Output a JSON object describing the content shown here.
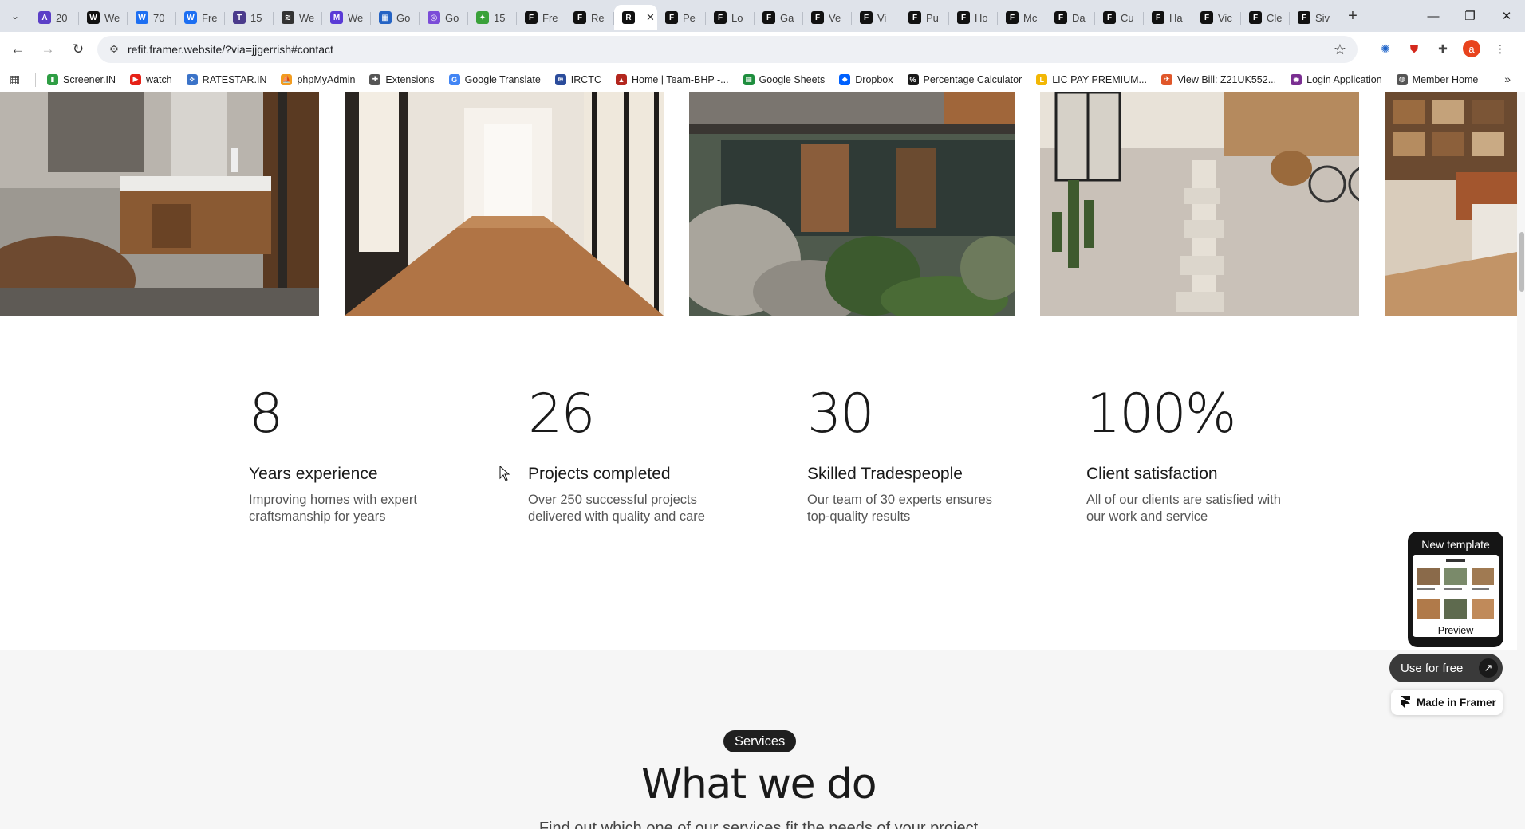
{
  "browser": {
    "tabs": [
      {
        "label": "20",
        "favicon": "arc-icon",
        "color": "#5b3fc7",
        "glyph": "A"
      },
      {
        "label": "We",
        "favicon": "wix-icon",
        "color": "#111111",
        "glyph": "W"
      },
      {
        "label": "70",
        "favicon": "framer-blue-icon",
        "color": "#1d6ff2",
        "glyph": "W"
      },
      {
        "label": "Fre",
        "favicon": "framer-blue-icon",
        "color": "#1d6ff2",
        "glyph": "W"
      },
      {
        "label": "15",
        "favicon": "template-icon",
        "color": "#4b3b8c",
        "glyph": "T"
      },
      {
        "label": "We",
        "favicon": "webflow-icon",
        "color": "#333333",
        "glyph": "≋"
      },
      {
        "label": "We",
        "favicon": "webflow-icon",
        "color": "#5a3bd6",
        "glyph": "M"
      },
      {
        "label": "Go",
        "favicon": "calendar-icon",
        "color": "#2463c4",
        "glyph": "▦"
      },
      {
        "label": "Go",
        "favicon": "circle-icon",
        "color": "#7b4cd8",
        "glyph": "◎"
      },
      {
        "label": "15",
        "favicon": "leaf-icon",
        "color": "#3aa13a",
        "glyph": "✦"
      },
      {
        "label": "Fre",
        "favicon": "framer-icon",
        "color": "#111111",
        "glyph": "F"
      },
      {
        "label": "Re",
        "favicon": "framer-icon",
        "color": "#111111",
        "glyph": "F"
      },
      {
        "label": "",
        "favicon": "refit-icon",
        "color": "#111111",
        "glyph": "R",
        "active": true
      },
      {
        "label": "Pe",
        "favicon": "framer-icon",
        "color": "#111111",
        "glyph": "F"
      },
      {
        "label": "Lo",
        "favicon": "framer-icon",
        "color": "#111111",
        "glyph": "F"
      },
      {
        "label": "Ga",
        "favicon": "framer-icon",
        "color": "#111111",
        "glyph": "F"
      },
      {
        "label": "Ve",
        "favicon": "framer-icon",
        "color": "#111111",
        "glyph": "F"
      },
      {
        "label": "Vi",
        "favicon": "framer-icon",
        "color": "#111111",
        "glyph": "F"
      },
      {
        "label": "Pu",
        "favicon": "framer-icon",
        "color": "#111111",
        "glyph": "F"
      },
      {
        "label": "Ho",
        "favicon": "framer-icon",
        "color": "#111111",
        "glyph": "F"
      },
      {
        "label": "Mc",
        "favicon": "framer-icon",
        "color": "#111111",
        "glyph": "F"
      },
      {
        "label": "Da",
        "favicon": "framer-icon",
        "color": "#111111",
        "glyph": "F"
      },
      {
        "label": "Cu",
        "favicon": "framer-icon",
        "color": "#111111",
        "glyph": "F"
      },
      {
        "label": "Ha",
        "favicon": "framer-icon",
        "color": "#111111",
        "glyph": "F"
      },
      {
        "label": "Vic",
        "favicon": "framer-icon",
        "color": "#111111",
        "glyph": "F"
      },
      {
        "label": "Cle",
        "favicon": "framer-icon",
        "color": "#111111",
        "glyph": "F"
      },
      {
        "label": "Siv",
        "favicon": "framer-icon",
        "color": "#111111",
        "glyph": "F"
      }
    ],
    "url": "refit.framer.website/?via=jjgerrish#contact",
    "bookmarks": [
      {
        "label": "Screener.IN",
        "icon": "bar-chart-icon",
        "color": "#2f9e44",
        "glyph": "▮"
      },
      {
        "label": "watch",
        "icon": "youtube-icon",
        "color": "#e62117",
        "glyph": "▶"
      },
      {
        "label": "RATESTAR.IN",
        "icon": "ratestar-icon",
        "color": "#3b73c8",
        "glyph": "⟡"
      },
      {
        "label": "phpMyAdmin",
        "icon": "phpmyadmin-icon",
        "color": "#f29c1f",
        "glyph": "⛵"
      },
      {
        "label": "Extensions",
        "icon": "puzzle-icon",
        "color": "#555555",
        "glyph": "✚"
      },
      {
        "label": "Google Translate",
        "icon": "translate-icon",
        "color": "#4285f4",
        "glyph": "G"
      },
      {
        "label": "IRCTC",
        "icon": "irctc-icon",
        "color": "#2b4c9b",
        "glyph": "⊛"
      },
      {
        "label": "Home | Team-BHP -...",
        "icon": "teambhp-icon",
        "color": "#b3261e",
        "glyph": "▲"
      },
      {
        "label": "Google Sheets",
        "icon": "sheets-icon",
        "color": "#1e8e3e",
        "glyph": "▦"
      },
      {
        "label": "Dropbox",
        "icon": "dropbox-icon",
        "color": "#0061fe",
        "glyph": "◆"
      },
      {
        "label": "Percentage Calculator",
        "icon": "calculator-icon",
        "color": "#1a1a1a",
        "glyph": "%"
      },
      {
        "label": "LIC PAY PREMIUM...",
        "icon": "lic-icon",
        "color": "#f2b705",
        "glyph": "L"
      },
      {
        "label": "View Bill: Z21UK552...",
        "icon": "bill-icon",
        "color": "#e0572a",
        "glyph": "✈"
      },
      {
        "label": "Login Application",
        "icon": "login-icon",
        "color": "#7a2e91",
        "glyph": "◉"
      },
      {
        "label": "Member Home",
        "icon": "globe-icon",
        "color": "#555555",
        "glyph": "◍"
      }
    ]
  },
  "page": {
    "stats": [
      {
        "number": "8",
        "title": "Years experience",
        "description": "Improving homes with expert craftsmanship for years"
      },
      {
        "number": "26",
        "title": "Projects completed",
        "description": "Over 250 successful projects delivered with quality and care"
      },
      {
        "number": "30",
        "title": "Skilled Tradespeople",
        "description": "Our team of 30 experts ensures top-quality results"
      },
      {
        "number": "100%",
        "title": "Client satisfaction",
        "description": "All of our clients are satisfied with our work and service"
      }
    ],
    "services": {
      "pill": "Services",
      "heading": "What we do",
      "subtext": "Find out which one of our services fit the needs of your project"
    }
  },
  "framer": {
    "template_title": "New template",
    "preview_label": "Preview",
    "use_free_label": "Use for free",
    "made_in_label": "Made in Framer"
  }
}
